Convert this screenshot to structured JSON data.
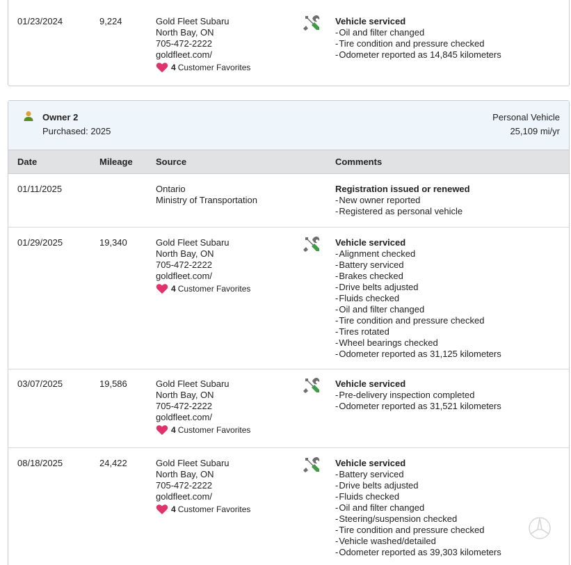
{
  "colors": {
    "heart": "#e0336b",
    "owner_icon": "#5a8a2e",
    "header_bg": "#e1e2e3",
    "owner_bg": "#eef5fb",
    "tool_gray": "#6e6e6e",
    "tool_green": "#3f9b47"
  },
  "top_record": {
    "date": "01/23/2024",
    "mileage": "9,224",
    "source": [
      "Gold Fleet Subaru",
      "North Bay, ON",
      "705-472-2222",
      "goldfleet.com/"
    ],
    "favorites_count": "4",
    "favorites_label": "Customer Favorites",
    "icon": "service-tools-icon",
    "comment_title": "Vehicle serviced",
    "comments": [
      "Oil and filter changed",
      "Tire condition and pressure checked",
      "Odometer reported as 14,845 kilometers"
    ]
  },
  "owner2": {
    "name": "Owner 2",
    "purchased": "Purchased: 2025",
    "vehicle_type": "Personal Vehicle",
    "rate": "25,109 mi/yr",
    "icon": "person-icon"
  },
  "table_headers": {
    "date": "Date",
    "mileage": "Mileage",
    "source": "Source",
    "comments": "Comments"
  },
  "records": [
    {
      "date": "01/11/2025",
      "mileage": "",
      "source": [
        "Ontario",
        "Ministry of Transportation"
      ],
      "favorites_count": "",
      "favorites_label": "",
      "comment_title": "Registration issued or renewed",
      "comments": [
        "New owner reported",
        "Registered as personal vehicle"
      ]
    },
    {
      "date": "01/29/2025",
      "mileage": "19,340",
      "source": [
        "Gold Fleet Subaru",
        "North Bay, ON",
        "705-472-2222",
        "goldfleet.com/"
      ],
      "favorites_count": "4",
      "favorites_label": "Customer Favorites",
      "comment_title": "Vehicle serviced",
      "comments": [
        "Alignment checked",
        "Battery serviced",
        "Brakes checked",
        "Drive belts adjusted",
        "Fluids checked",
        "Oil and filter changed",
        "Tire condition and pressure checked",
        "Tires rotated",
        "Wheel bearings checked",
        "Odometer reported as 31,125 kilometers"
      ]
    },
    {
      "date": "03/07/2025",
      "mileage": "19,586",
      "source": [
        "Gold Fleet Subaru",
        "North Bay, ON",
        "705-472-2222",
        "goldfleet.com/"
      ],
      "favorites_count": "4",
      "favorites_label": "Customer Favorites",
      "comment_title": "Vehicle serviced",
      "comments": [
        "Pre-delivery inspection completed",
        "Odometer reported as 31,521 kilometers"
      ]
    },
    {
      "date": "08/18/2025",
      "mileage": "24,422",
      "source": [
        "Gold Fleet Subaru",
        "North Bay, ON",
        "705-472-2222",
        "goldfleet.com/"
      ],
      "favorites_count": "4",
      "favorites_label": "Customer Favorites",
      "comment_title": "Vehicle serviced",
      "comments": [
        "Battery serviced",
        "Drive belts adjusted",
        "Fluids checked",
        "Oil and filter changed",
        "Steering/suspension checked",
        "Tire condition and pressure checked",
        "Vehicle washed/detailed",
        "Odometer reported as 39,303 kilometers"
      ]
    }
  ]
}
